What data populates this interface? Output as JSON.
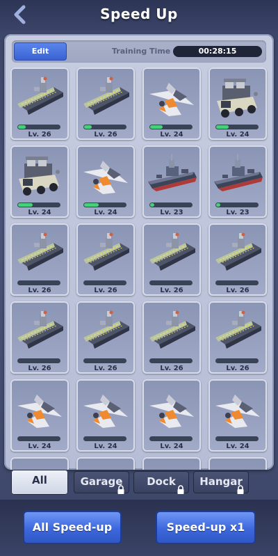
{
  "header": {
    "title": "Speed Up",
    "back_icon": "chevron-left-icon"
  },
  "topbar": {
    "edit_label": "Edit",
    "training_time_label": "Training Time",
    "training_time_value": "00:28:15"
  },
  "units": [
    {
      "type": "carrier",
      "level": "Lv. 26",
      "progress": 0.18
    },
    {
      "type": "carrier",
      "level": "Lv. 26",
      "progress": 0.18
    },
    {
      "type": "jet",
      "level": "Lv. 24",
      "progress": 0.3
    },
    {
      "type": "truck",
      "level": "Lv. 24",
      "progress": 0.3
    },
    {
      "type": "truck",
      "level": "Lv. 24",
      "progress": 0.35
    },
    {
      "type": "jet",
      "level": "Lv. 24",
      "progress": 0.35
    },
    {
      "type": "destroyer",
      "level": "Lv. 23",
      "progress": 0.1
    },
    {
      "type": "destroyer",
      "level": "Lv. 23",
      "progress": 0.1
    },
    {
      "type": "carrier",
      "level": "Lv. 26",
      "progress": 0
    },
    {
      "type": "carrier",
      "level": "Lv. 26",
      "progress": 0
    },
    {
      "type": "carrier",
      "level": "Lv. 26",
      "progress": 0
    },
    {
      "type": "carrier",
      "level": "Lv. 26",
      "progress": 0
    },
    {
      "type": "carrier",
      "level": "Lv. 26",
      "progress": 0
    },
    {
      "type": "carrier",
      "level": "Lv. 26",
      "progress": 0
    },
    {
      "type": "carrier",
      "level": "Lv. 26",
      "progress": 0
    },
    {
      "type": "carrier",
      "level": "Lv. 26",
      "progress": 0
    },
    {
      "type": "jet",
      "level": "Lv. 24",
      "progress": 0
    },
    {
      "type": "jet",
      "level": "Lv. 24",
      "progress": 0
    },
    {
      "type": "jet",
      "level": "Lv. 24",
      "progress": 0
    },
    {
      "type": "jet",
      "level": "Lv. 24",
      "progress": 0
    }
  ],
  "tabs": [
    {
      "label": "All",
      "active": true,
      "locked": false
    },
    {
      "label": "Garage",
      "active": false,
      "locked": true
    },
    {
      "label": "Dock",
      "active": false,
      "locked": true
    },
    {
      "label": "Hangar",
      "active": false,
      "locked": true
    }
  ],
  "footer": {
    "all_speedup_label": "All Speed-up",
    "speedup_label": "Speed-up x1"
  },
  "colors": {
    "accent_blue": "#3d68dc",
    "progress_green": "#46d07a",
    "panel": "#c7cde0"
  }
}
